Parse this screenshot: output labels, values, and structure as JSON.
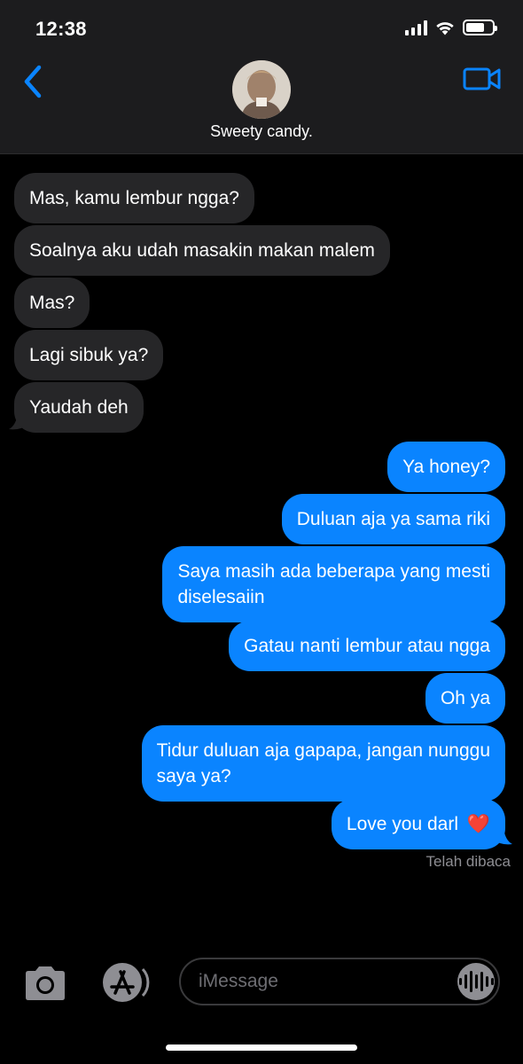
{
  "status_bar": {
    "time": "12:38"
  },
  "contact": {
    "name": "Sweety candy."
  },
  "messages": [
    {
      "side": "in",
      "text": "Mas, kamu lembur ngga?"
    },
    {
      "side": "in",
      "text": "Soalnya aku udah masakin makan malem"
    },
    {
      "side": "in",
      "text": "Mas?"
    },
    {
      "side": "in",
      "text": "Lagi sibuk ya?"
    },
    {
      "side": "in",
      "text": "Yaudah deh"
    },
    {
      "side": "out",
      "text": "Ya honey?"
    },
    {
      "side": "out",
      "text": "Duluan aja ya sama riki"
    },
    {
      "side": "out",
      "line1": "Saya masih ada beberapa yang mesti",
      "line2": "diselesaiin"
    },
    {
      "side": "out",
      "text": "Gatau nanti lembur atau ngga"
    },
    {
      "side": "out",
      "text": "Oh ya"
    },
    {
      "side": "out",
      "line1": "Tidur duluan aja gapapa, jangan nunggu",
      "line2": "saya ya?"
    },
    {
      "side": "out",
      "text": "Love you darl",
      "emoji": "❤️"
    }
  ],
  "read_receipt": "Telah dibaca",
  "composer": {
    "placeholder": "iMessage"
  },
  "icons": {
    "back": "chevron-left-icon",
    "video": "video-camera-icon",
    "camera": "camera-icon",
    "apps": "app-store-icon",
    "audio": "audio-waveform-icon"
  },
  "colors": {
    "accent": "#0a84ff",
    "incoming_bubble": "#262628",
    "background": "#000000"
  }
}
